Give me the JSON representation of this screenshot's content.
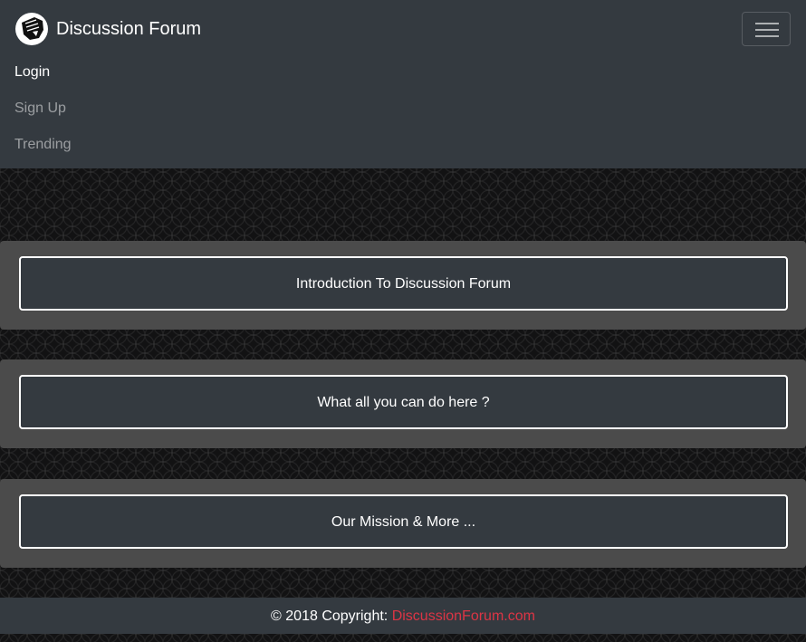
{
  "navbar": {
    "brand_name": "Discussion Forum",
    "logo_icon": "fist-icon",
    "toggler_icon": "hamburger-menu-icon",
    "links": [
      {
        "label": "Login",
        "active": true
      },
      {
        "label": "Sign Up",
        "active": false
      },
      {
        "label": "Trending",
        "active": false
      }
    ]
  },
  "cards": [
    {
      "label": "Introduction To Discussion Forum"
    },
    {
      "label": "What all you can do here ?"
    },
    {
      "label": "Our Mission & More ..."
    }
  ],
  "footer": {
    "copyright_prefix": "© 2018 Copyright: ",
    "link_text": "DiscussionForum.com"
  },
  "colors": {
    "navbar_bg": "#343a40",
    "card_bg": "#4b4b4b",
    "footer_link": "#dc3545",
    "page_bg": "#121213"
  }
}
